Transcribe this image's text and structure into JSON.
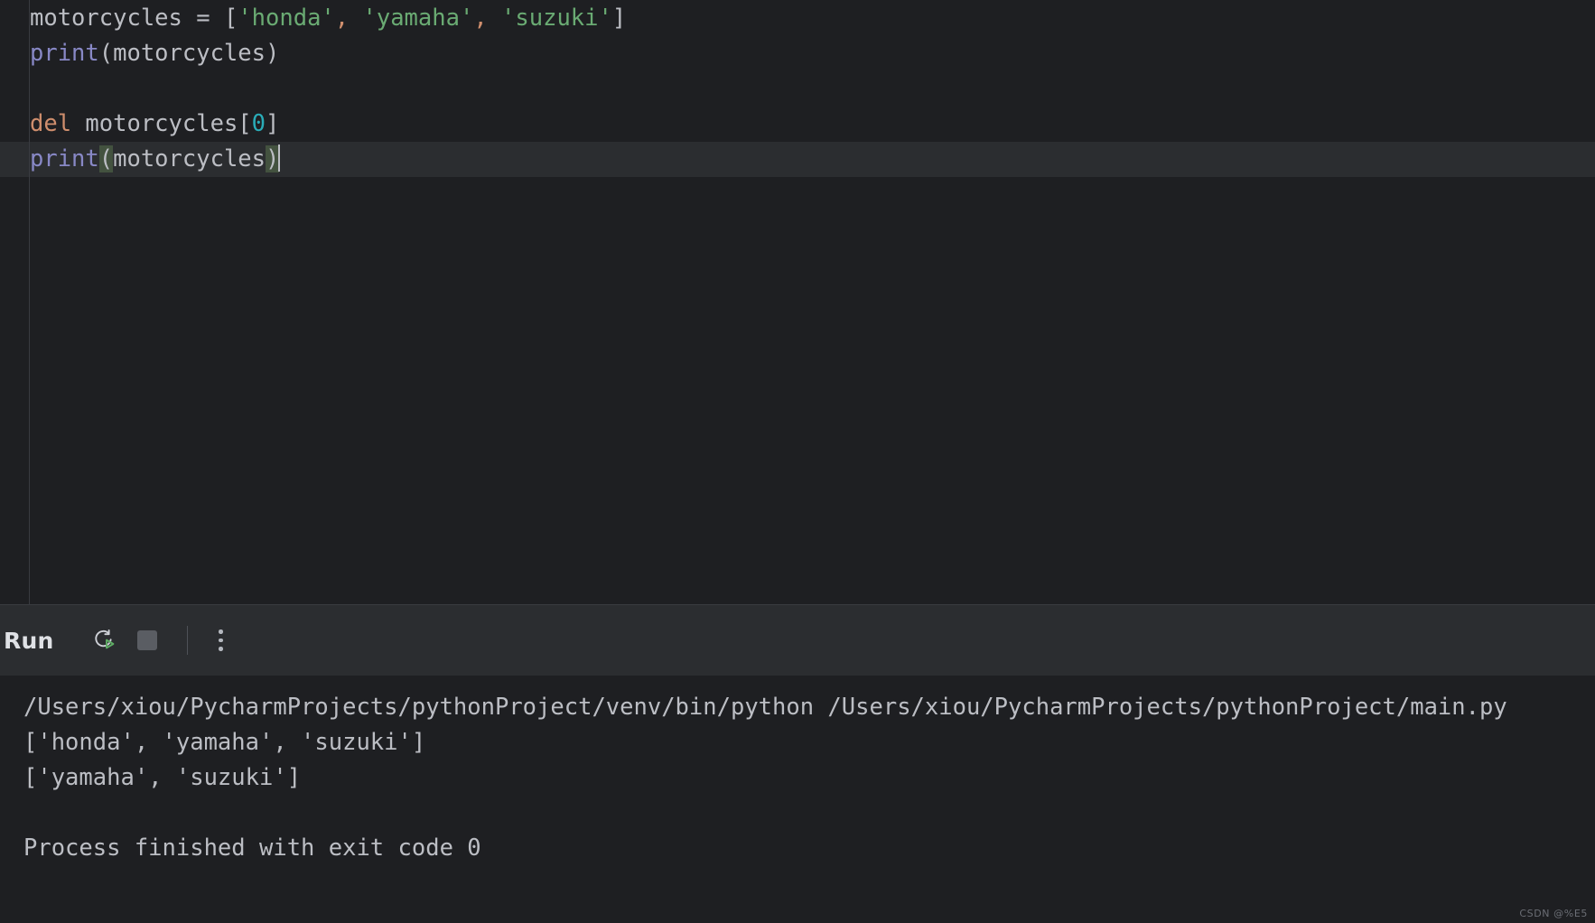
{
  "editor": {
    "name": "python-code-editor",
    "language": "python",
    "lines": [
      {
        "index": 1,
        "current": false,
        "text": "motorcycles = ['honda', 'yamaha', 'suzuki']",
        "tokens": [
          {
            "t": "motorcycles ",
            "c": "tok-plain"
          },
          {
            "t": "= ",
            "c": "tok-plain"
          },
          {
            "t": "[",
            "c": "tok-punct"
          },
          {
            "t": "'honda'",
            "c": "tok-string"
          },
          {
            "t": ",",
            "c": "tok-comma"
          },
          {
            "t": " ",
            "c": "tok-plain"
          },
          {
            "t": "'yamaha'",
            "c": "tok-string"
          },
          {
            "t": ",",
            "c": "tok-comma"
          },
          {
            "t": " ",
            "c": "tok-plain"
          },
          {
            "t": "'suzuki'",
            "c": "tok-string"
          },
          {
            "t": "]",
            "c": "tok-punct"
          }
        ]
      },
      {
        "index": 2,
        "current": false,
        "text": "print(motorcycles)",
        "tokens": [
          {
            "t": "print",
            "c": "tok-func"
          },
          {
            "t": "(motorcycles)",
            "c": "tok-plain"
          }
        ]
      },
      {
        "index": 3,
        "current": false,
        "text": "",
        "tokens": []
      },
      {
        "index": 4,
        "current": false,
        "text": "del motorcycles[0]",
        "tokens": [
          {
            "t": "del",
            "c": "tok-keyword"
          },
          {
            "t": " motorcycles[",
            "c": "tok-plain"
          },
          {
            "t": "0",
            "c": "tok-number"
          },
          {
            "t": "]",
            "c": "tok-plain"
          }
        ]
      },
      {
        "index": 5,
        "current": true,
        "text": "print(motorcycles)",
        "tokens": [
          {
            "t": "print",
            "c": "tok-func"
          },
          {
            "t": "(",
            "c": "tok-bracketmatch"
          },
          {
            "t": "motorcycles",
            "c": "tok-plain"
          },
          {
            "t": ")",
            "c": "tok-bracketmatch"
          }
        ],
        "caret_after": true
      }
    ]
  },
  "run_panel": {
    "title": "Run",
    "buttons": [
      {
        "name": "rerun-button",
        "icon": "rerun-icon",
        "label": "Rerun"
      },
      {
        "name": "stop-button",
        "icon": "stop-icon",
        "label": "Stop"
      },
      {
        "name": "more-options-button",
        "icon": "more-vertical-icon",
        "label": "More Options"
      }
    ],
    "console_lines": [
      "/Users/xiou/PycharmProjects/pythonProject/venv/bin/python /Users/xiou/PycharmProjects/pythonProject/main.py",
      "['honda', 'yamaha', 'suzuki']",
      "['yamaha', 'suzuki']",
      "",
      "Process finished with exit code 0"
    ]
  },
  "watermark": "CSDN @%E5",
  "colors": {
    "editor_background": "#1e1f22",
    "current_line_background": "#2b2d30",
    "toolbar_background": "#2b2d30",
    "string": "#6aab73",
    "keyword": "#cf8e6d",
    "function": "#8888c6",
    "number": "#2aacb8",
    "text": "#bcbec4",
    "bracket_match": "#43523f",
    "play_green": "#5fad65"
  }
}
